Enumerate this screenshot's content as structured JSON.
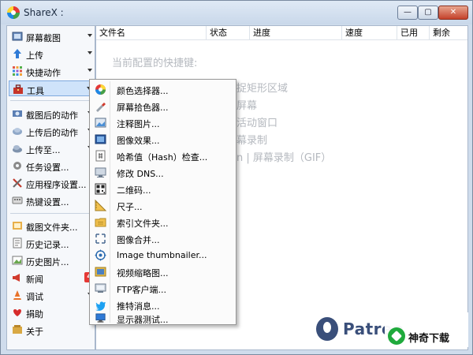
{
  "window": {
    "title": "ShareX :",
    "min_label": "—",
    "max_label": "▢",
    "close_label": "✕"
  },
  "sidebar": {
    "items": [
      {
        "label": "屏幕截图",
        "icon": "capture-icon"
      },
      {
        "label": "上传",
        "icon": "upload-icon"
      },
      {
        "label": "快捷动作",
        "icon": "workflows-icon"
      },
      {
        "label": "工具",
        "icon": "toolbox-icon"
      },
      {
        "label": "截图后的动作",
        "icon": "after-capture-icon"
      },
      {
        "label": "上传后的动作",
        "icon": "after-upload-icon"
      },
      {
        "label": "上传至...",
        "icon": "destinations-icon"
      },
      {
        "label": "任务设置...",
        "icon": "task-settings-icon"
      },
      {
        "label": "应用程序设置...",
        "icon": "app-settings-icon"
      },
      {
        "label": "热键设置...",
        "icon": "hotkey-settings-icon"
      },
      {
        "label": "截图文件夹...",
        "icon": "screenshots-folder-icon"
      },
      {
        "label": "历史记录...",
        "icon": "history-icon"
      },
      {
        "label": "历史图片...",
        "icon": "image-history-icon"
      },
      {
        "label": "新闻",
        "icon": "news-icon",
        "badge": "4"
      },
      {
        "label": "调试",
        "icon": "debug-icon"
      },
      {
        "label": "捐助",
        "icon": "donate-icon"
      },
      {
        "label": "关于",
        "icon": "about-icon"
      }
    ]
  },
  "table": {
    "columns": [
      "文件名",
      "状态",
      "进度",
      "速度",
      "已用",
      "剩余"
    ]
  },
  "hotkeys": {
    "heading": "当前配置的快捷键:",
    "lines": [
      "捉矩形区域",
      "屏幕",
      "活动窗口",
      "幕录制",
      "n | 屏幕录制（GIF）"
    ]
  },
  "tools_menu": {
    "items": [
      {
        "label": "颜色选择器...",
        "icon": "color-picker-icon"
      },
      {
        "label": "屏幕拾色器...",
        "icon": "screen-color-picker-icon"
      },
      {
        "label": "注释图片...",
        "icon": "image-editor-icon"
      },
      {
        "label": "图像效果...",
        "icon": "image-effects-icon"
      },
      {
        "label": "哈希值（Hash）检查...",
        "icon": "hash-check-icon"
      },
      {
        "label": "修改 DNS...",
        "icon": "dns-changer-icon"
      },
      {
        "label": "二维码...",
        "icon": "qr-code-icon"
      },
      {
        "label": "尺子...",
        "icon": "ruler-icon"
      },
      {
        "label": "索引文件夹...",
        "icon": "index-folder-icon"
      },
      {
        "label": "图像合并...",
        "icon": "image-combiner-icon"
      },
      {
        "label": "Image thumbnailer...",
        "icon": "image-thumbnailer-icon"
      },
      {
        "label": "视频缩略图...",
        "icon": "video-thumbnailer-icon"
      },
      {
        "label": "FTP客户端...",
        "icon": "ftp-client-icon"
      },
      {
        "label": "推特消息...",
        "icon": "tweet-icon"
      },
      {
        "label": "显示器测试...",
        "icon": "monitor-test-icon"
      }
    ]
  },
  "patreon": {
    "text": "Patreo"
  },
  "watermark": {
    "text": "神奇下载"
  }
}
